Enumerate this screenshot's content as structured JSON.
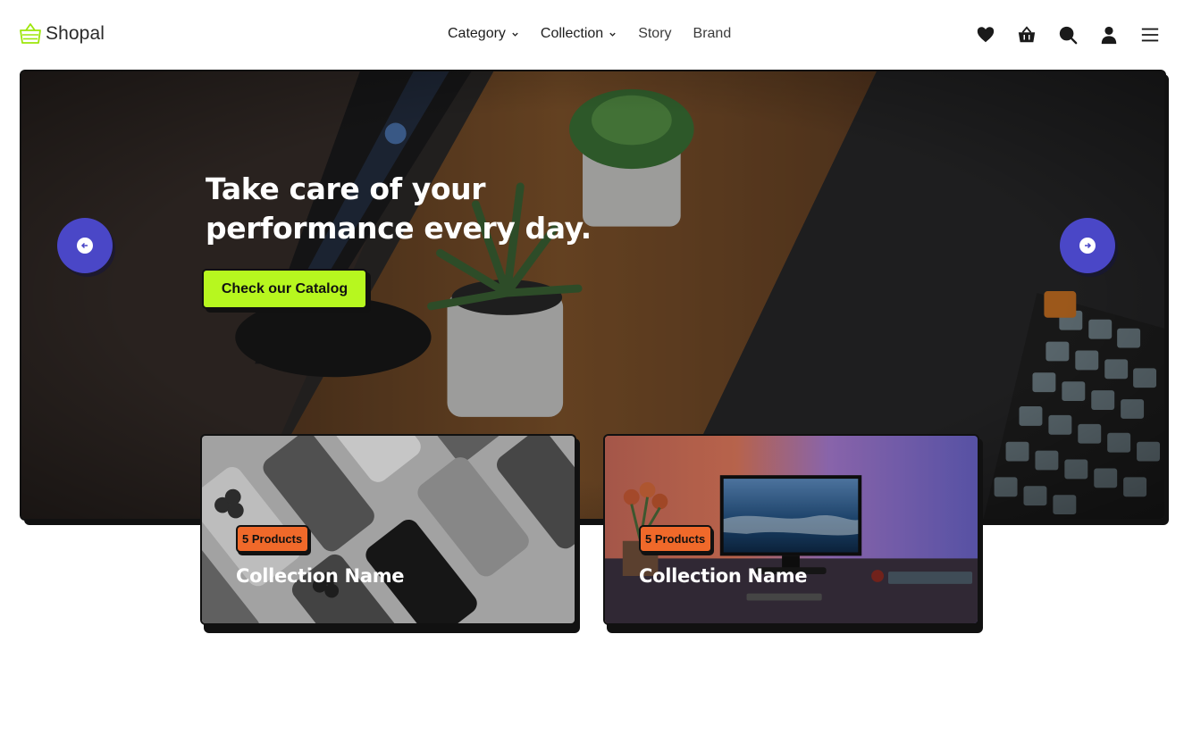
{
  "brand": {
    "name": "Shopal",
    "logo_icon": "basket-icon",
    "accent": "#b7f71f"
  },
  "nav": {
    "items": [
      {
        "label": "Category",
        "has_dropdown": true
      },
      {
        "label": "Collection",
        "has_dropdown": true
      },
      {
        "label": "Story",
        "has_dropdown": false
      },
      {
        "label": "Brand",
        "has_dropdown": false
      }
    ]
  },
  "header_icons": [
    "heart-icon",
    "basket-icon",
    "search-icon",
    "user-icon",
    "menu-icon"
  ],
  "hero": {
    "title": "Take care of your performance every day.",
    "cta_label": "Check our Catalog",
    "cta_color": "#b7f71f",
    "arrow_color": "#4a47c7"
  },
  "collections": [
    {
      "badge": "5 Products",
      "title": "Collection Name",
      "image": "phones-flatlay"
    },
    {
      "badge": "5 Products",
      "title": "Collection Name",
      "image": "desk-monitor"
    }
  ],
  "badge_color": "#f0692a"
}
